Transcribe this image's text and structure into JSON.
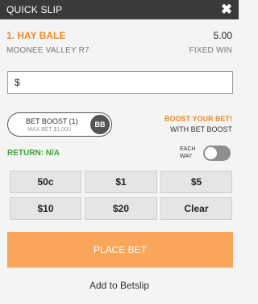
{
  "header": {
    "title": "QUICK SLIP",
    "close_icon": "close-icon",
    "close_glyph": "✖"
  },
  "selection": {
    "runner": "1. HAY BALE",
    "price": "5.00",
    "race": "MOONEE VALLEY R7",
    "bet_type": "FIXED WIN"
  },
  "stake": {
    "currency": "$",
    "value": ""
  },
  "bet_boost": {
    "label": "BET BOOST (1)",
    "max_bet": "MAX BET $1,000",
    "badge": "BB",
    "promo_title": "BOOST YOUR BET!",
    "promo_subtitle": "WITH BET BOOST"
  },
  "return_text": "RETURN: N/A",
  "each_way": {
    "label_line1": "EACH",
    "label_line2": "WAY",
    "enabled": false
  },
  "quick_stakes": [
    "50c",
    "$1",
    "$5",
    "$10",
    "$20",
    "Clear"
  ],
  "actions": {
    "place_bet": "PLACE BET",
    "add_to_betslip": "Add to Betslip"
  },
  "colors": {
    "header_bg": "#3a3a3a",
    "accent_orange": "#f08a24",
    "place_bet_bg": "#f9a55a",
    "return_green": "#3aa335"
  }
}
